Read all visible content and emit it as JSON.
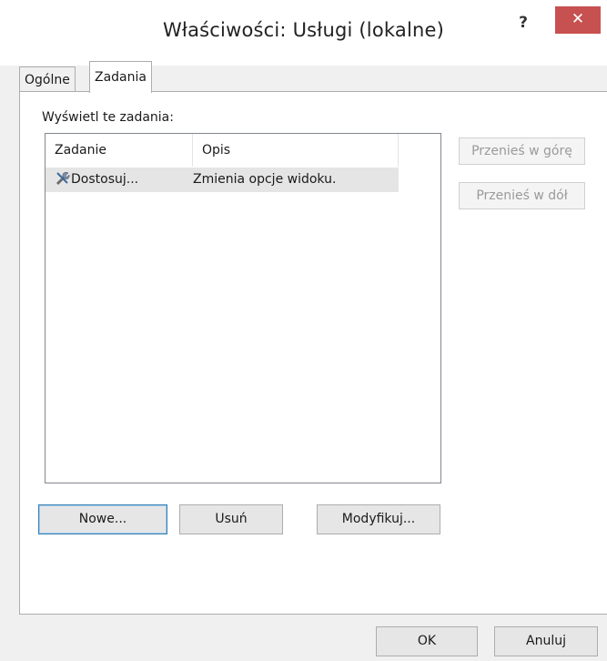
{
  "window": {
    "title": "Właściwości: Usługi (lokalne)",
    "help_label": "?",
    "close_label": "✕"
  },
  "tabs": [
    {
      "label": "Ogólne",
      "active": false
    },
    {
      "label": "Zadania",
      "active": true
    }
  ],
  "tasks": {
    "section_label": "Wyświetl te zadania:",
    "columns": [
      "Zadanie",
      "Opis"
    ],
    "rows": [
      {
        "name": "Dostosuj...",
        "description": "Zmienia opcje widoku.",
        "icon": "tools-icon"
      }
    ]
  },
  "side_buttons": {
    "move_up": "Przenieś w górę",
    "move_down": "Przenieś w dół"
  },
  "actions": {
    "new": "Nowe...",
    "delete": "Usuń",
    "modify": "Modyfikuj..."
  },
  "footer": {
    "ok": "OK",
    "cancel": "Anuluj"
  },
  "colors": {
    "close_bg": "#c75050",
    "selected_row": "#e5e5e5",
    "primary_border": "#3c7fb1"
  }
}
